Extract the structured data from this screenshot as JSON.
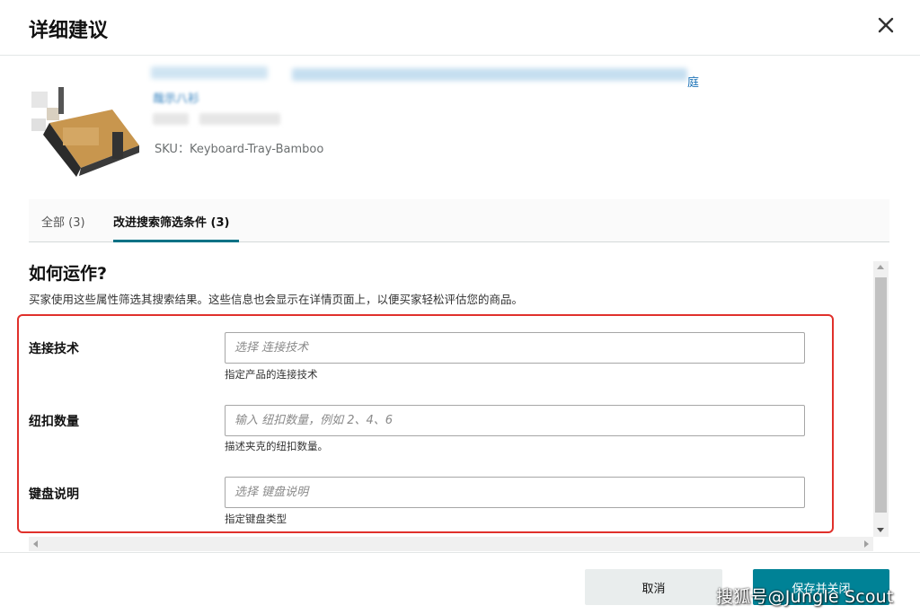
{
  "dialog": {
    "title": "详细建议",
    "close_icon": "close-icon"
  },
  "product": {
    "title_visible_tail": "庭",
    "title_line2": "哉示八衫",
    "sku": "SKU：Keyboard-Tray-Bamboo"
  },
  "tabs": [
    {
      "label": "全部 (3)",
      "active": false
    },
    {
      "label": "改进搜索筛选条件 (3)",
      "active": true
    }
  ],
  "section": {
    "title": "如何运作?",
    "description": "买家使用这些属性筛选其搜索结果。这些信息也会显示在详情页面上，以便买家轻松评估您的商品。"
  },
  "fields": [
    {
      "label": "连接技术",
      "placeholder": "选择 连接技术",
      "hint": "指定产品的连接技术"
    },
    {
      "label": "纽扣数量",
      "placeholder": "输入 纽扣数量，例如 2、4、6",
      "hint": "描述夹克的纽扣数量。"
    },
    {
      "label": "键盘说明",
      "placeholder": "选择 键盘说明",
      "hint": "指定键盘类型"
    }
  ],
  "footer": {
    "cancel_label": "取消",
    "save_label": "保存并关闭"
  },
  "watermark": "搜狐号@Jungle Scout",
  "colors": {
    "accent": "#007185",
    "primary_button": "#008296",
    "highlight_border": "#e0302b",
    "link": "#1e74b8"
  }
}
